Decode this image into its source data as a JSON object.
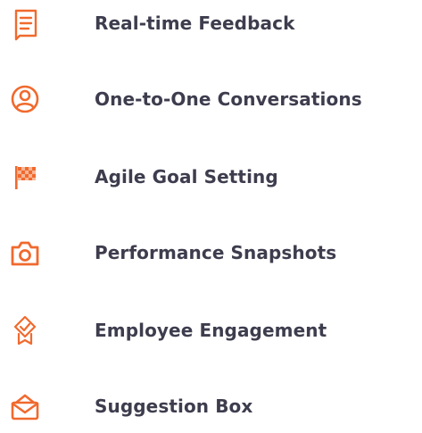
{
  "colors": {
    "accent": "#f06a2e",
    "text": "#3d3d4e"
  },
  "features": [
    {
      "label": "Real-time Feedback",
      "icon": "feedback-document-icon"
    },
    {
      "label": "One-to-One Conversations",
      "icon": "user-circle-icon"
    },
    {
      "label": "Agile Goal Setting",
      "icon": "checkered-flag-icon"
    },
    {
      "label": "Performance Snapshots",
      "icon": "camera-icon"
    },
    {
      "label": "Employee Engagement",
      "icon": "badge-check-icon"
    },
    {
      "label": "Suggestion Box",
      "icon": "envelope-box-icon"
    }
  ]
}
